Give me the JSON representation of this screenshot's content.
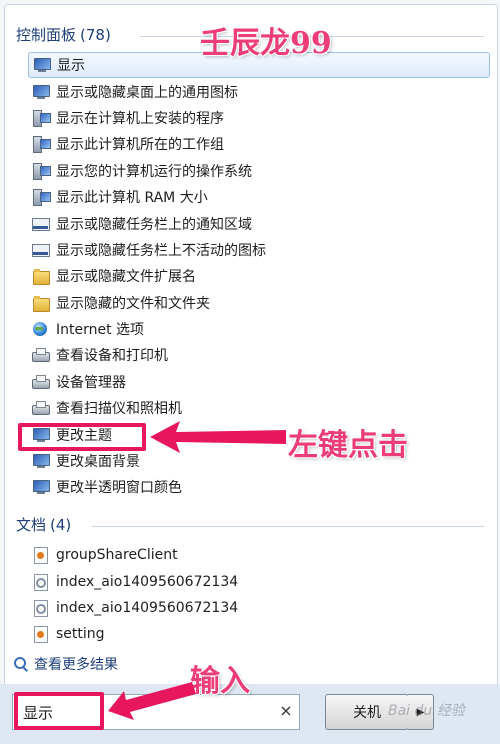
{
  "start_menu": {
    "control_panel": {
      "title": "控制面板",
      "count": "(78)",
      "items": [
        {
          "label": "显示",
          "icon": "monitor-icon",
          "selected": true
        },
        {
          "label": "显示或隐藏桌面上的通用图标",
          "icon": "monitor-icon"
        },
        {
          "label": "显示在计算机上安装的程序",
          "icon": "computer-icon"
        },
        {
          "label": "显示此计算机所在的工作组",
          "icon": "computer-icon"
        },
        {
          "label": "显示您的计算机运行的操作系统",
          "icon": "computer-icon"
        },
        {
          "label": "显示此计算机 RAM 大小",
          "icon": "computer-icon"
        },
        {
          "label": "显示或隐藏任务栏上的通知区域",
          "icon": "taskbar-icon"
        },
        {
          "label": "显示或隐藏任务栏上不活动的图标",
          "icon": "taskbar-icon"
        },
        {
          "label": "显示或隐藏文件扩展名",
          "icon": "folder-icon"
        },
        {
          "label": "显示隐藏的文件和文件夹",
          "icon": "folder-icon"
        },
        {
          "label": "Internet 选项",
          "icon": "globe-icon"
        },
        {
          "label": "查看设备和打印机",
          "icon": "device-icon"
        },
        {
          "label": "设备管理器",
          "icon": "device-icon"
        },
        {
          "label": "查看扫描仪和照相机",
          "icon": "device-icon"
        },
        {
          "label": "更改主题",
          "icon": "monitor-icon"
        },
        {
          "label": "更改桌面背景",
          "icon": "monitor-icon"
        },
        {
          "label": "更改半透明窗口颜色",
          "icon": "monitor-icon"
        }
      ]
    },
    "documents": {
      "title": "文档",
      "count": "(4)",
      "items": [
        {
          "label": "groupShareClient",
          "icon": "document-icon"
        },
        {
          "label": "index_aio1409560672134",
          "icon": "settings-file-icon"
        },
        {
          "label": "index_aio1409560672134",
          "icon": "settings-file-icon"
        },
        {
          "label": "setting",
          "icon": "document-icon"
        }
      ]
    },
    "see_more": "查看更多结果",
    "search": {
      "value": "显示"
    },
    "shutdown": {
      "label": "关机",
      "arrow": "▶"
    },
    "clear_symbol": "×"
  },
  "annotations": {
    "author": "壬辰龙99",
    "click_hint": "左键点击",
    "input_hint": "输入",
    "watermark": "Bai du 经验"
  },
  "colors": {
    "annotation": "#e8175d",
    "group_header": "#1e3f7a",
    "selection": "#deebfb"
  }
}
